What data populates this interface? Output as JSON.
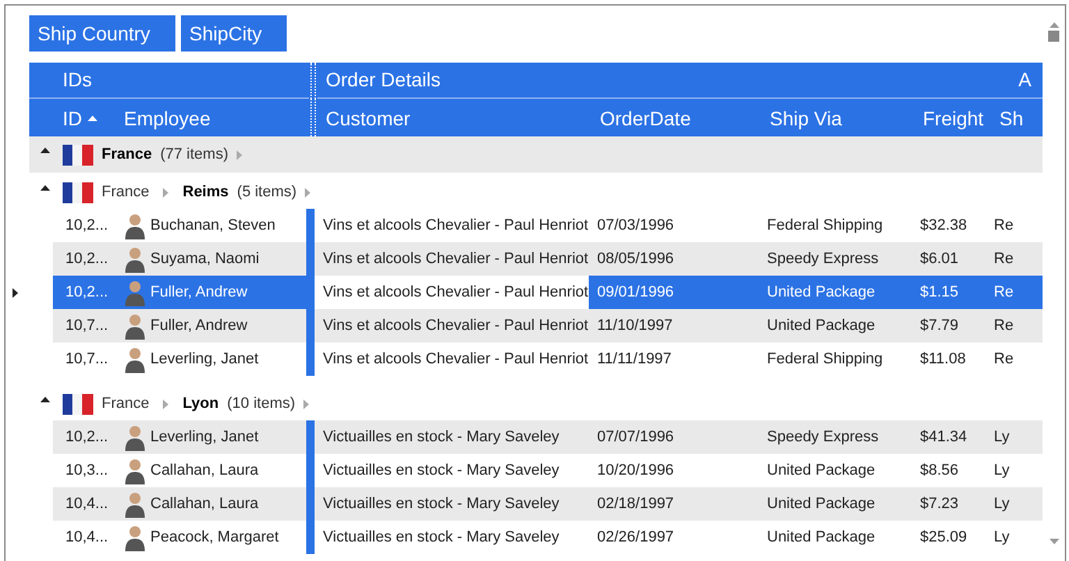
{
  "group_panel": [
    {
      "label": "Ship Country"
    },
    {
      "label": "ShipCity"
    }
  ],
  "header": {
    "bands": [
      {
        "kind": "ids",
        "label": "IDs"
      },
      {
        "kind": "details",
        "label": "Order Details"
      },
      {
        "kind": "extra",
        "label": "A"
      }
    ],
    "columns": [
      {
        "label": "ID",
        "sorted": true,
        "current": false
      },
      {
        "label": "Employee",
        "sorted": false,
        "current": false
      },
      {
        "label": "Customer",
        "sorted": false,
        "current": true
      },
      {
        "label": "OrderDate",
        "sorted": false,
        "current": false
      },
      {
        "label": "Ship Via",
        "sorted": false,
        "current": false
      },
      {
        "label": "Freight",
        "sorted": false,
        "current": false
      },
      {
        "label": "Sh",
        "sorted": false,
        "current": false
      }
    ]
  },
  "groups": [
    {
      "label": "France",
      "count": "(77 items)",
      "expanded": true,
      "subgroups": [
        {
          "parent": "France",
          "label": "Reims",
          "count": "(5 items)",
          "expanded": true,
          "rows": [
            {
              "cells": [
                "10,2...",
                "Buchanan, Steven",
                "Vins et alcools Chevalier - Paul Henriot",
                "07/03/1996",
                "Federal Shipping",
                "$32.38",
                "Re"
              ],
              "shaded": false,
              "selected": false
            },
            {
              "cells": [
                "10,2...",
                "Suyama, Naomi",
                "Vins et alcools Chevalier - Paul Henriot",
                "08/05/1996",
                "Speedy Express",
                "$6.01",
                "Re"
              ],
              "shaded": true,
              "selected": false
            },
            {
              "cells": [
                "10,2...",
                "Fuller, Andrew",
                "Vins et alcools Chevalier - Paul Henriot",
                "09/01/1996",
                "United Package",
                "$1.15",
                "Re"
              ],
              "shaded": false,
              "selected": true
            },
            {
              "cells": [
                "10,7...",
                "Fuller, Andrew",
                "Vins et alcools Chevalier - Paul Henriot",
                "11/10/1997",
                "United Package",
                "$7.79",
                "Re"
              ],
              "shaded": true,
              "selected": false
            },
            {
              "cells": [
                "10,7...",
                "Leverling, Janet",
                "Vins et alcools Chevalier - Paul Henriot",
                "11/11/1997",
                "Federal Shipping",
                "$11.08",
                "Re"
              ],
              "shaded": false,
              "selected": false
            }
          ]
        },
        {
          "parent": "France",
          "label": "Lyon",
          "count": "(10 items)",
          "expanded": true,
          "rows": [
            {
              "cells": [
                "10,2...",
                "Leverling, Janet",
                "Victuailles en stock - Mary Saveley",
                "07/07/1996",
                "Speedy Express",
                "$41.34",
                "Ly"
              ],
              "shaded": true,
              "selected": false
            },
            {
              "cells": [
                "10,3...",
                "Callahan, Laura",
                "Victuailles en stock - Mary Saveley",
                "10/20/1996",
                "United Package",
                "$8.56",
                "Ly"
              ],
              "shaded": false,
              "selected": false
            },
            {
              "cells": [
                "10,4...",
                "Callahan, Laura",
                "Victuailles en stock - Mary Saveley",
                "02/18/1997",
                "United Package",
                "$7.23",
                "Ly"
              ],
              "shaded": true,
              "selected": false
            },
            {
              "cells": [
                "10,4...",
                "Peacock, Margaret",
                "Victuailles en stock - Mary Saveley",
                "02/26/1997",
                "United Package",
                "$25.09",
                "Ly"
              ],
              "shaded": false,
              "selected": false
            }
          ]
        }
      ]
    }
  ]
}
